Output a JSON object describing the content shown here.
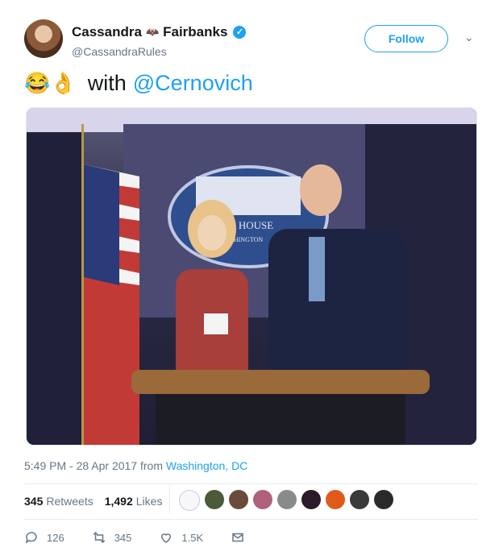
{
  "author": {
    "first_name": "Cassandra",
    "last_name": "Fairbanks",
    "handle": "@CassandraRules"
  },
  "follow_label": "Follow",
  "tweet": {
    "emojis": "😂👌",
    "word": "with",
    "mention": "@Cernovich"
  },
  "photo": {
    "sign_text": "TE HOUSE",
    "sign_sub": "HINGTON"
  },
  "timestamp": {
    "time": "5:49 PM - 28 Apr 2017 from",
    "location": "Washington, DC"
  },
  "stats": {
    "retweets_count": "345",
    "retweets_label": "Retweets",
    "likes_count": "1,492",
    "likes_label": "Likes"
  },
  "actions": {
    "replies": "126",
    "retweets": "345",
    "likes": "1.5K"
  },
  "colors": {
    "accent": "#1da1f2",
    "muted": "#657786"
  }
}
